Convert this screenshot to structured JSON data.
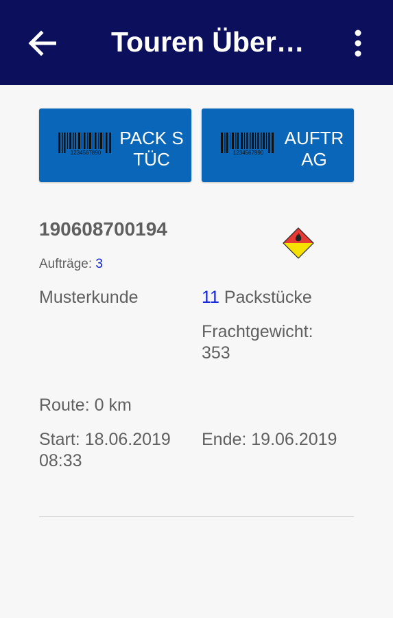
{
  "appbar": {
    "title": "Touren Übers…",
    "back_icon": "arrow-left-icon",
    "more_icon": "more-vert-icon",
    "bg_color": "#0b0f5c"
  },
  "actions": [
    {
      "label": "PACK STÜC",
      "icon": "barcode-icon"
    },
    {
      "label": "AUFTR AG",
      "icon": "barcode-icon"
    }
  ],
  "barcode_digits": "1234567890",
  "tour": {
    "id": "190608700194",
    "hazard_icon": "hazard-placard-icon",
    "orders_label": "Aufträge:",
    "orders_count": "3",
    "customer": "Musterkunde",
    "packages_count": "11",
    "packages_label": "Packstücke",
    "weight_label": "Frachtgewicht:",
    "weight_value": "353",
    "route": "Route: 0 km",
    "start": "Start: 18.06.2019 08:33",
    "end": "Ende: 19.06.2019"
  },
  "colors": {
    "button": "#0a66b8",
    "highlight": "#1024d8"
  }
}
